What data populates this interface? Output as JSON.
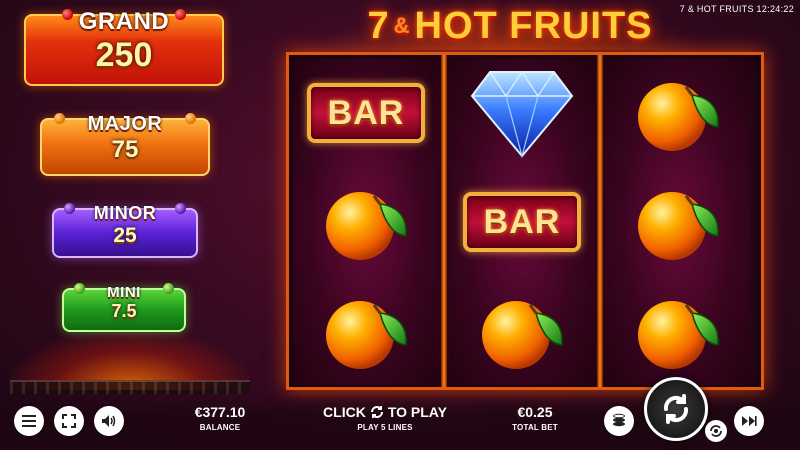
{
  "window": {
    "title": "7 & HOT FRUITS 12:24:22"
  },
  "game": {
    "title_part1": "7",
    "title_amp": "&",
    "title_part2": "HOT FRUITS"
  },
  "jackpots": [
    {
      "name": "GRAND",
      "value": "250",
      "color": "#e3300b"
    },
    {
      "name": "MAJOR",
      "value": "75",
      "color": "#f07010"
    },
    {
      "name": "MINOR",
      "value": "25",
      "color": "#5a22d6"
    },
    {
      "name": "MINI",
      "value": "7.5",
      "color": "#1f9a1c"
    }
  ],
  "reels": [
    [
      "bar",
      "orange",
      "orange"
    ],
    [
      "diamond",
      "bar",
      "orange"
    ],
    [
      "orange",
      "orange",
      "orange"
    ]
  ],
  "symbols": {
    "bar_label": "BAR"
  },
  "bottom": {
    "balance_value": "€377.10",
    "balance_label": "BALANCE",
    "click_left": "CLICK",
    "click_right": "TO PLAY",
    "lines_label": "PLAY 5 LINES",
    "bet_value": "€0.25",
    "bet_label": "TOTAL BET"
  },
  "icons": {
    "menu": "menu-icon",
    "fullscreen": "fullscreen-icon",
    "sound": "speaker-icon",
    "coins": "coins-icon",
    "spin": "spin-icon",
    "autoplay": "autoplay-icon",
    "turbo": "fast-forward-icon"
  }
}
